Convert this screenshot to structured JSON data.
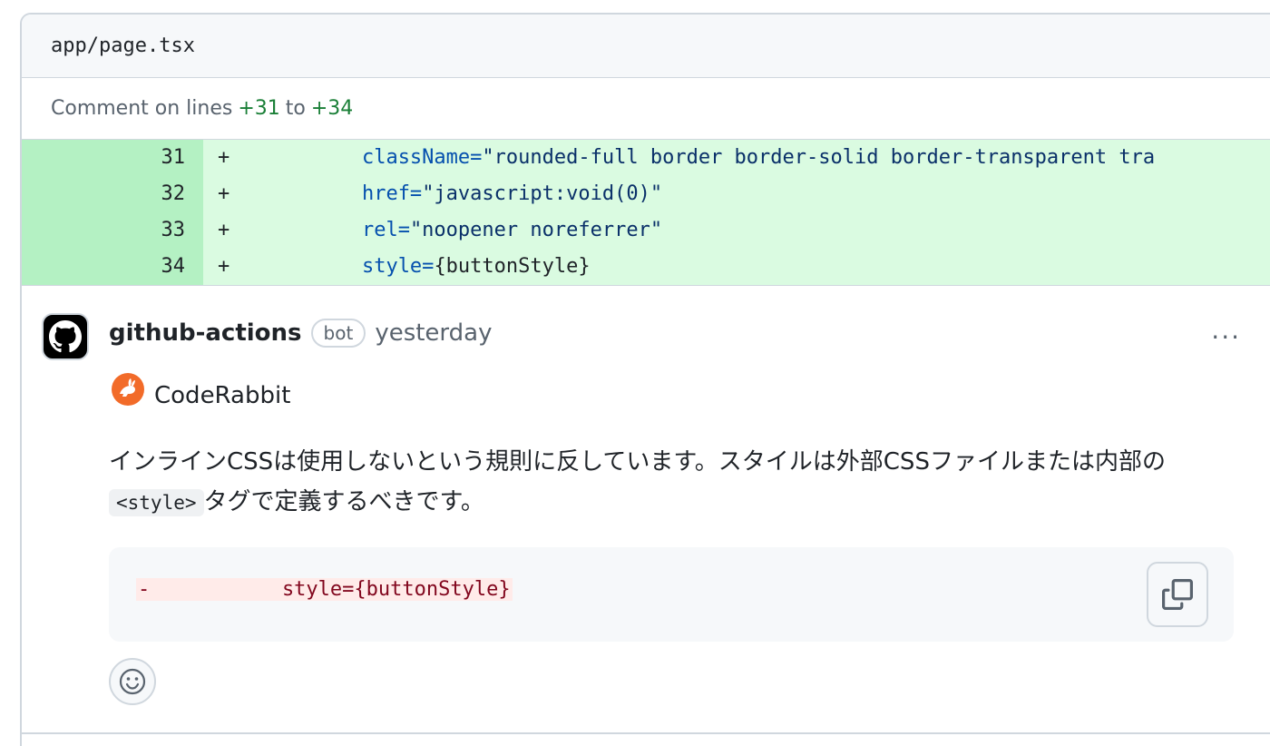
{
  "file": {
    "path": "app/page.tsx"
  },
  "comment_range": {
    "prefix": "Comment on lines",
    "start": "+31",
    "middle": "to",
    "end": "+34"
  },
  "diff_lines": [
    {
      "num": "31",
      "sign": "+",
      "indent": "           ",
      "attr": "className=",
      "value": "\"rounded-full border border-solid border-transparent tra"
    },
    {
      "num": "32",
      "sign": "+",
      "indent": "           ",
      "attr": "href=",
      "value": "\"javascript:void(0)\""
    },
    {
      "num": "33",
      "sign": "+",
      "indent": "           ",
      "attr": "rel=",
      "value": "\"noopener noreferrer\""
    },
    {
      "num": "34",
      "sign": "+",
      "indent": "           ",
      "attr": "style=",
      "value": "{buttonStyle}"
    }
  ],
  "comment": {
    "author": "github-actions",
    "badge": "bot",
    "time": "yesterday",
    "more": "···",
    "bot_name": "CodeRabbit",
    "text_part1": "インラインCSSは使用しないという規則に反しています。スタイルは外部CSSファイルまたは内部の",
    "inline_code": "<style>",
    "text_part2": "タグで定義するべきです。",
    "suggestion": "-           style={buttonStyle}"
  },
  "icons": {
    "avatar": "github-octocat-icon",
    "bot_logo": "coderabbit-icon",
    "copy": "copy-icon",
    "emoji": "smiley-icon"
  },
  "colors": {
    "added_line_bg": "#dafbe1",
    "added_num_bg": "#b4f1c3",
    "removed_bg": "#ffebe9",
    "removed_text": "#82071e",
    "link_green": "#1a7f37",
    "coderabbit_orange": "#f26b29"
  }
}
